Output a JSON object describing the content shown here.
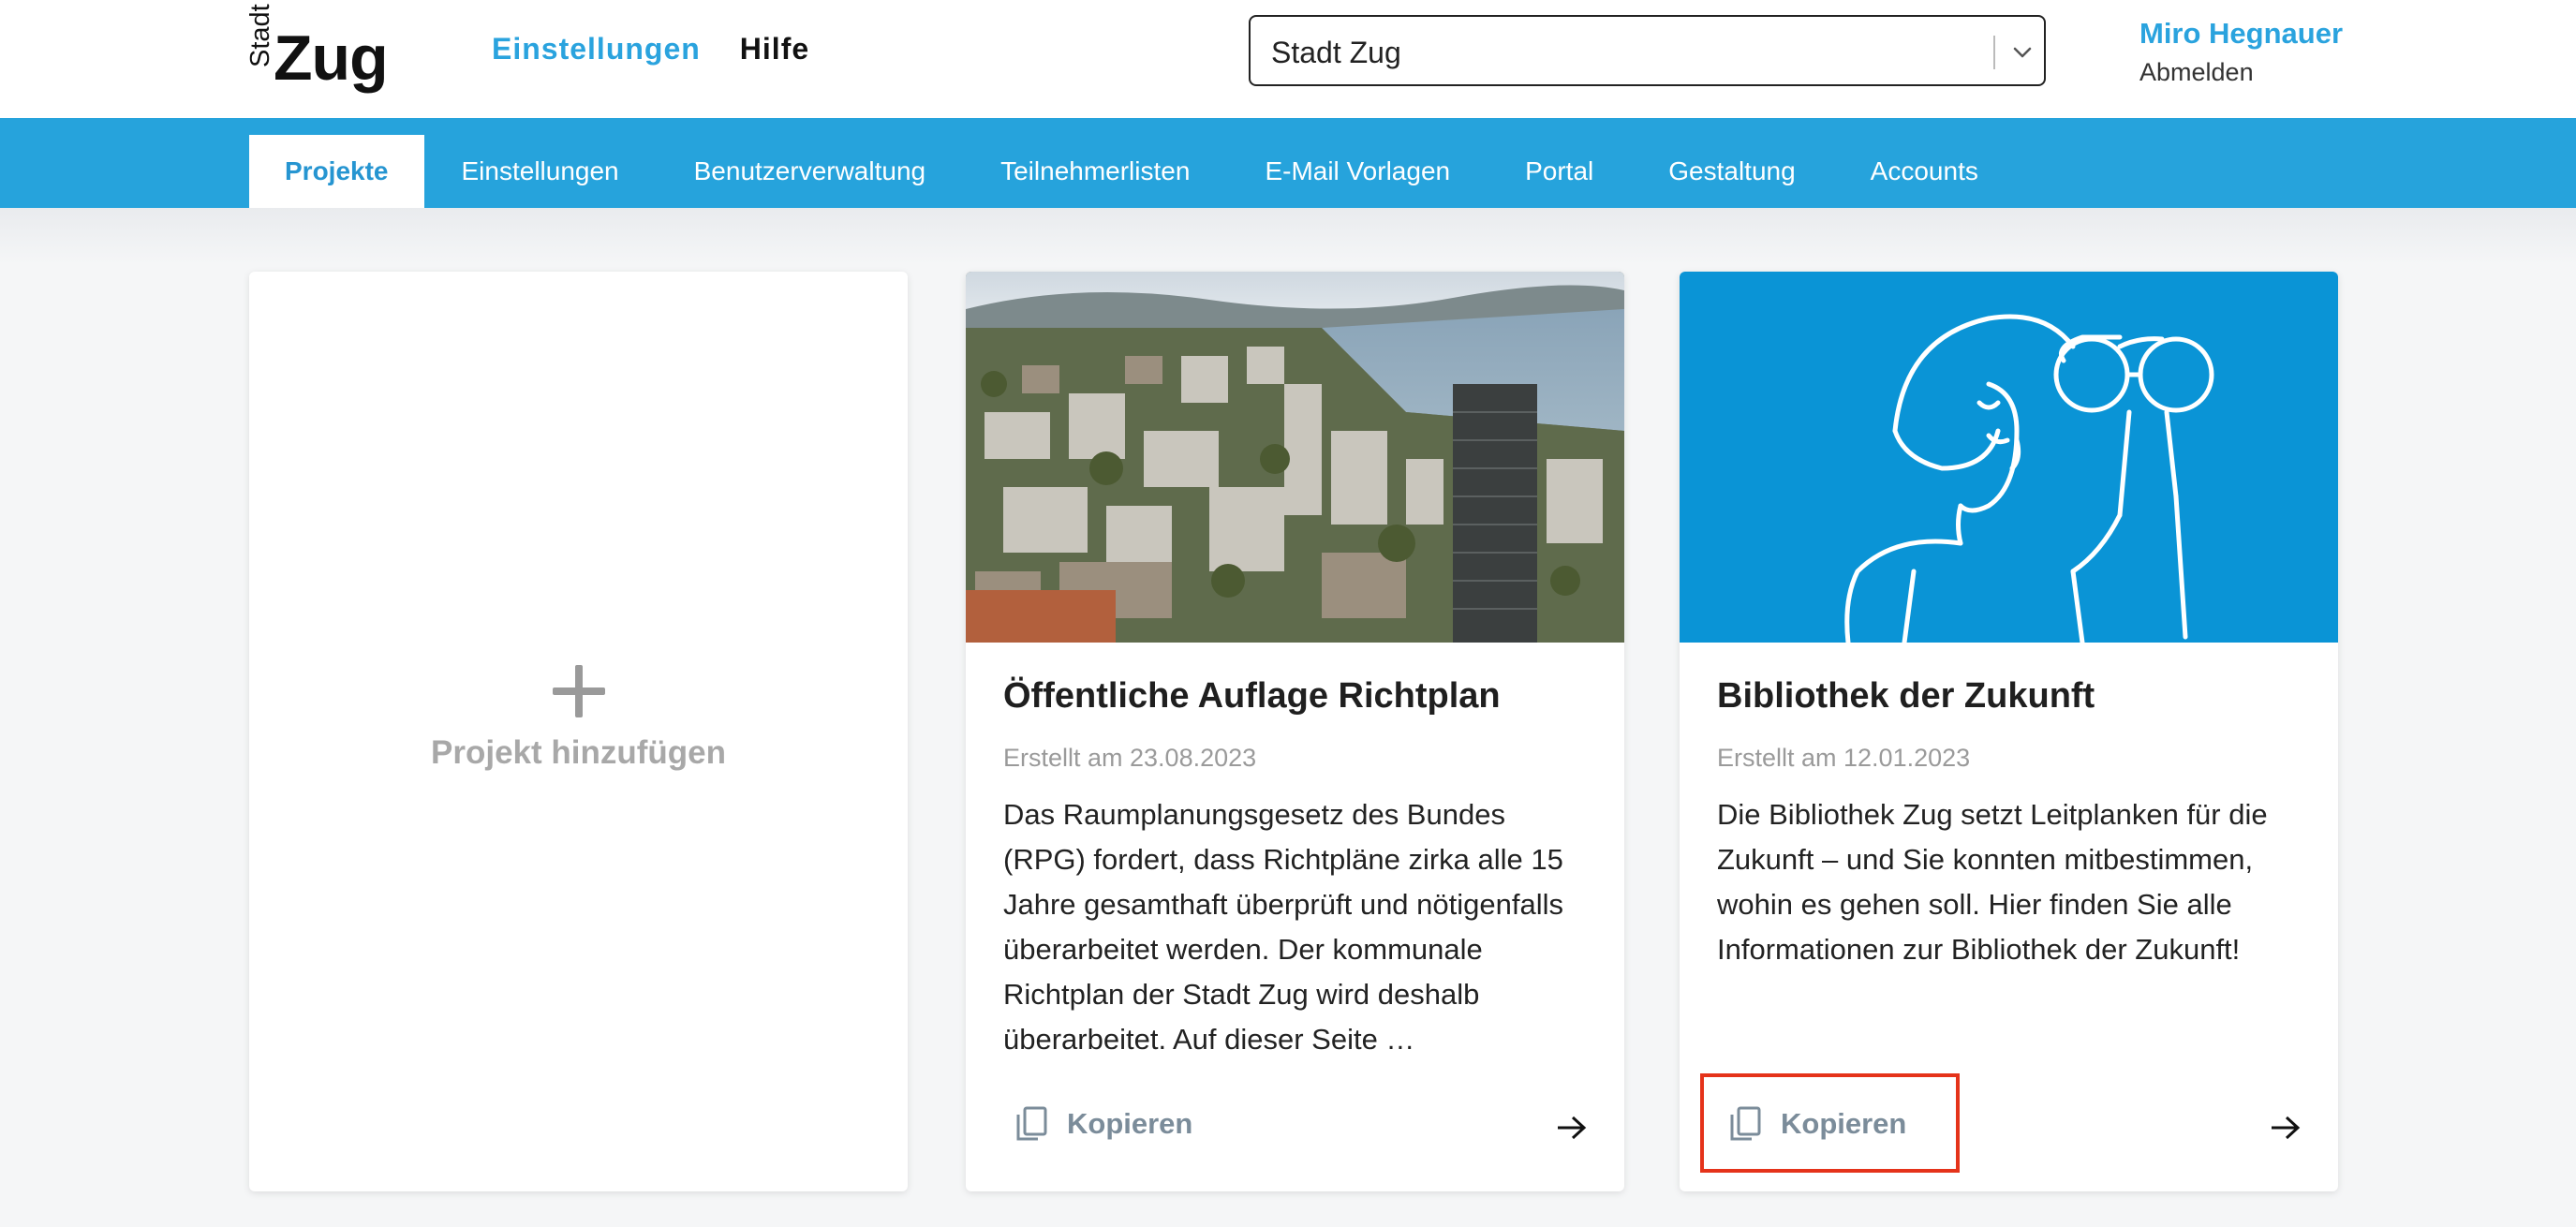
{
  "logo": {
    "small": "Stadt",
    "big": "Zug"
  },
  "topnav": {
    "settings": "Einstellungen",
    "help": "Hilfe"
  },
  "tenant_select": {
    "value": "Stadt Zug"
  },
  "user": {
    "name": "Miro Hegnauer",
    "logout": "Abmelden"
  },
  "tabs": [
    {
      "label": "Projekte",
      "active": true
    },
    {
      "label": "Einstellungen"
    },
    {
      "label": "Benutzerverwaltung"
    },
    {
      "label": "Teilnehmerlisten"
    },
    {
      "label": "E-Mail Vorlagen"
    },
    {
      "label": "Portal"
    },
    {
      "label": "Gestaltung"
    },
    {
      "label": "Accounts"
    }
  ],
  "add_card": {
    "label": "Projekt hinzufügen"
  },
  "projects": [
    {
      "title": "Öffentliche Auflage Richtplan",
      "date": "Erstellt am 23.08.2023",
      "description": "Das Raumplanungsgesetz des Bundes (RPG) fordert, dass Richtpläne zirka alle 15 Jahre gesamthaft überprüft und nötigenfalls überarbeitet werden. Der kommunale Richtplan der Stadt Zug wird deshalb überarbeitet. Auf dieser Seite …",
      "copy_label": "Kopieren"
    },
    {
      "title": "Bibliothek der Zukunft",
      "date": "Erstellt am 12.01.2023",
      "description": "Die Bibliothek Zug setzt Leitplanken für die Zukunft – und Sie konnten mitbestimmen, wohin es gehen soll. Hier finden Sie alle Informationen zur Bibliothek der Zukunft!",
      "copy_label": "Kopieren"
    }
  ],
  "colors": {
    "accent": "#26a3dc",
    "highlight": "#e5331a",
    "muted": "#7b8c9a"
  },
  "icons": {
    "copy": "copy-icon",
    "arrow": "arrow-right-icon",
    "plus": "plus-icon",
    "chevron": "chevron-down-icon"
  }
}
